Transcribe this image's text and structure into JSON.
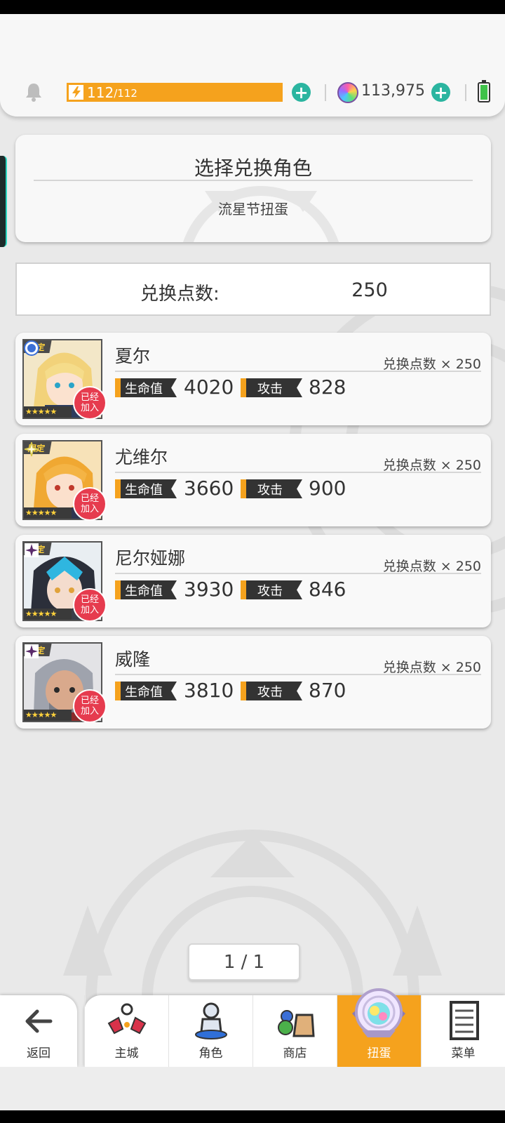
{
  "header": {
    "stamina_current": "112",
    "stamina_max": "/112",
    "gems": "113,975"
  },
  "panel": {
    "title": "选择兑换角色",
    "subtitle": "流星节扭蛋"
  },
  "exchange": {
    "label": "兑换点数:",
    "value": "250"
  },
  "labels": {
    "limited": "限定",
    "stars": "★★★★★",
    "joined_line1": "已经",
    "joined_line2": "加入",
    "hp": "生命值",
    "atk": "攻击"
  },
  "characters": [
    {
      "name": "夏尔",
      "cost": "兑换点数 × 250",
      "hp": "4020",
      "atk": "828",
      "attribute": "water-circle-icon"
    },
    {
      "name": "尤维尔",
      "cost": "兑换点数 × 250",
      "hp": "3660",
      "atk": "900",
      "attribute": "light-sparkle-icon"
    },
    {
      "name": "尼尔娅娜",
      "cost": "兑换点数 × 250",
      "hp": "3930",
      "atk": "846",
      "attribute": "dark-star-icon"
    },
    {
      "name": "威隆",
      "cost": "兑换点数 × 250",
      "hp": "3810",
      "atk": "870",
      "attribute": "dark-star-icon"
    }
  ],
  "pager": "1 / 1",
  "nav": {
    "back": "返回",
    "items": [
      "主城",
      "角色",
      "商店",
      "扭蛋",
      "菜单"
    ],
    "active": "扭蛋"
  },
  "colors": {
    "accent": "#f5a21d",
    "plus": "#2bb5a0",
    "badge": "#e63b4e"
  }
}
